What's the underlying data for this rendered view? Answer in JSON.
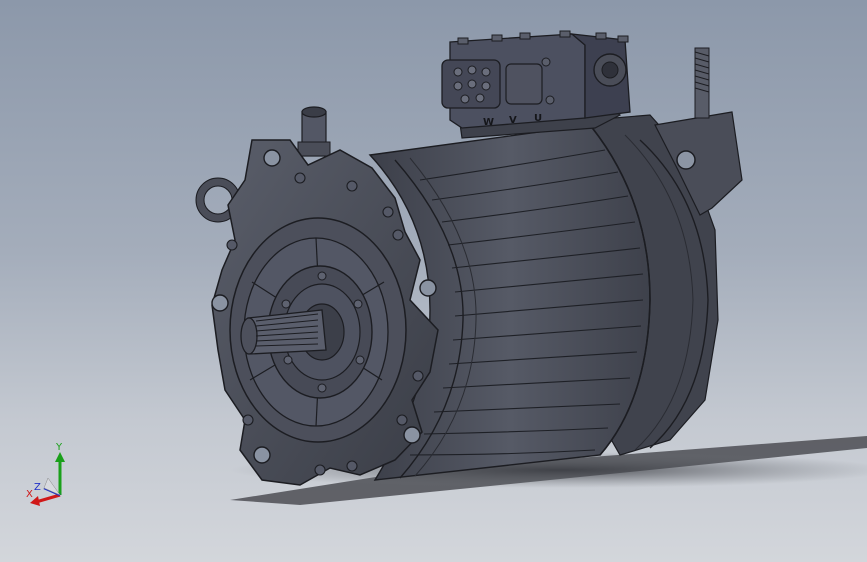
{
  "connector": {
    "phase_labels": [
      "W",
      "V",
      "U"
    ]
  },
  "triad": {
    "y_label": "Y",
    "z_label": "Z",
    "x_label": "X",
    "colors": {
      "x": "#d01818",
      "y": "#1aa01a",
      "z": "#2030c8"
    }
  },
  "model": {
    "body_color": "#4a4d58",
    "edge_color": "#1c1d22",
    "shadow_color": "#505258"
  }
}
